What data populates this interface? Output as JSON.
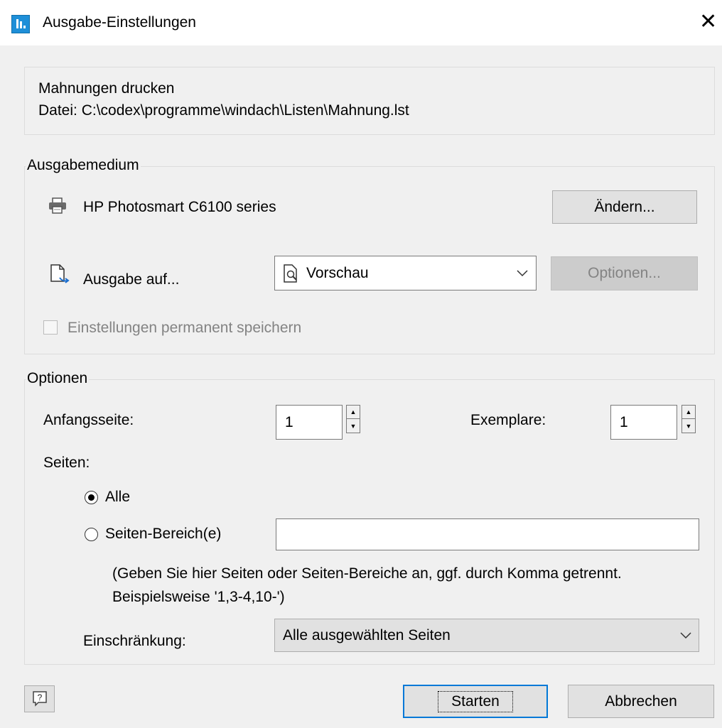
{
  "window": {
    "title": "Ausgabe-Einstellungen"
  },
  "header": {
    "line1": "Mahnungen drucken",
    "line2": "Datei: C:\\codex\\programme\\windach\\Listen\\Mahnung.lst"
  },
  "ausgabemedium": {
    "legend": "Ausgabemedium",
    "printer_name": "HP Photosmart C6100 series",
    "change_label": "Ändern...",
    "output_label": "Ausgabe auf...",
    "output_value": "Vorschau",
    "options_label": "Optionen...",
    "save_label": "Einstellungen permanent speichern"
  },
  "optionen": {
    "legend": "Optionen",
    "start_label": "Anfangsseite:",
    "start_value": "1",
    "copies_label": "Exemplare:",
    "copies_value": "1",
    "pages_label": "Seiten:",
    "radio_all": "Alle",
    "radio_range": "Seiten-Bereich(e)",
    "range_value": "",
    "hint_line1": "(Geben Sie hier Seiten oder Seiten-Bereiche an, ggf. durch Komma getrennt.",
    "hint_line2": "Beispielsweise '1,3-4,10-')",
    "restriction_label": "Einschränkung:",
    "restriction_value": "Alle ausgewählten Seiten"
  },
  "footer": {
    "start_label": "Starten",
    "cancel_label": "Abbrechen"
  },
  "icons": {
    "app": "app-icon",
    "close": "close-icon",
    "printer": "printer-icon",
    "output": "output-document-icon",
    "preview": "preview-icon",
    "help": "help-icon"
  }
}
